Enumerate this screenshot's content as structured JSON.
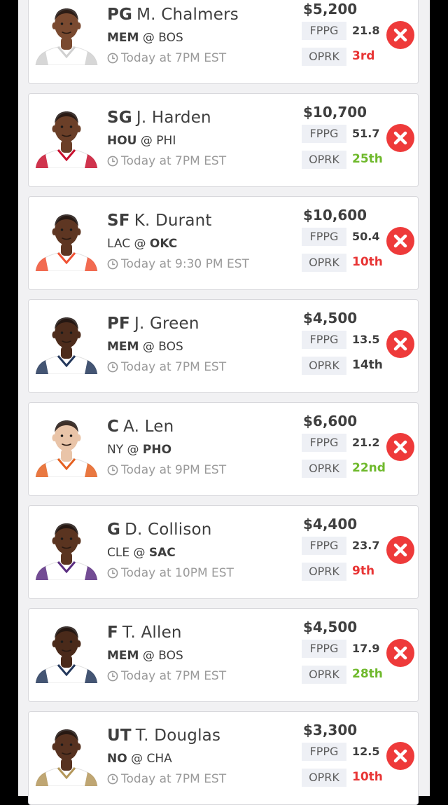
{
  "colors": {
    "rank_bad": "#e83535",
    "rank_good": "#6fb92c",
    "rank_neutral": "#3e3e3e",
    "remove": "#ee3a3a"
  },
  "labels": {
    "fppg": "FPPG",
    "oprk": "OPRK"
  },
  "players": [
    {
      "pos": "PG",
      "name": "M. Chalmers",
      "away": "MEM",
      "at": "@",
      "home": "BOS",
      "bold": "away",
      "time": "Today at 7PM EST",
      "salary": "$5,200",
      "fppg": "21.8",
      "oprk": "3rd",
      "oprk_color": "#e83535",
      "jersey": "#ffffff",
      "jersey_trim": "#d0d0d0",
      "skin": "#7a4a30"
    },
    {
      "pos": "SG",
      "name": "J. Harden",
      "away": "HOU",
      "at": "@",
      "home": "PHI",
      "bold": "away",
      "time": "Today at 7PM EST",
      "salary": "$10,700",
      "fppg": "51.7",
      "oprk": "25th",
      "oprk_color": "#6fb92c",
      "jersey": "#ffffff",
      "jersey_trim": "#c8102e",
      "skin": "#6b3f28"
    },
    {
      "pos": "SF",
      "name": "K. Durant",
      "away": "LAC",
      "at": "@",
      "home": "OKC",
      "bold": "home",
      "time": "Today at 9:30 PM EST",
      "salary": "$10,600",
      "fppg": "50.4",
      "oprk": "10th",
      "oprk_color": "#e83535",
      "jersey": "#ffffff",
      "jersey_trim": "#f05133",
      "skin": "#5e3622"
    },
    {
      "pos": "PF",
      "name": "J. Green",
      "away": "MEM",
      "at": "@",
      "home": "BOS",
      "bold": "away",
      "time": "Today at 7PM EST",
      "salary": "$4,500",
      "fppg": "13.5",
      "oprk": "14th",
      "oprk_color": "#3e3e3e",
      "jersey": "#ffffff",
      "jersey_trim": "#23375b",
      "skin": "#4d2c1c"
    },
    {
      "pos": "C",
      "name": "A. Len",
      "away": "NY",
      "at": "@",
      "home": "PHO",
      "bold": "home",
      "time": "Today at 9PM EST",
      "salary": "$6,600",
      "fppg": "21.2",
      "oprk": "22nd",
      "oprk_color": "#6fb92c",
      "jersey": "#ffffff",
      "jersey_trim": "#e56020",
      "skin": "#e9c4a8"
    },
    {
      "pos": "G",
      "name": "D. Collison",
      "away": "CLE",
      "at": "@",
      "home": "SAC",
      "bold": "home",
      "time": "Today at 10PM EST",
      "salary": "$4,400",
      "fppg": "23.7",
      "oprk": "9th",
      "oprk_color": "#e83535",
      "jersey": "#ffffff",
      "jersey_trim": "#5a2d81",
      "skin": "#5a3420"
    },
    {
      "pos": "F",
      "name": "T. Allen",
      "away": "MEM",
      "at": "@",
      "home": "BOS",
      "bold": "away",
      "time": "Today at 7PM EST",
      "salary": "$4,500",
      "fppg": "17.9",
      "oprk": "28th",
      "oprk_color": "#6fb92c",
      "jersey": "#ffffff",
      "jersey_trim": "#23375b",
      "skin": "#4a2a1a"
    },
    {
      "pos": "UT",
      "name": "T. Douglas",
      "away": "NO",
      "at": "@",
      "home": "CHA",
      "bold": "away",
      "time": "Today at 7PM EST",
      "salary": "$3,300",
      "fppg": "12.5",
      "oprk": "10th",
      "oprk_color": "#e83535",
      "jersey": "#ffffff",
      "jersey_trim": "#b4975a",
      "skin": "#573220"
    }
  ]
}
